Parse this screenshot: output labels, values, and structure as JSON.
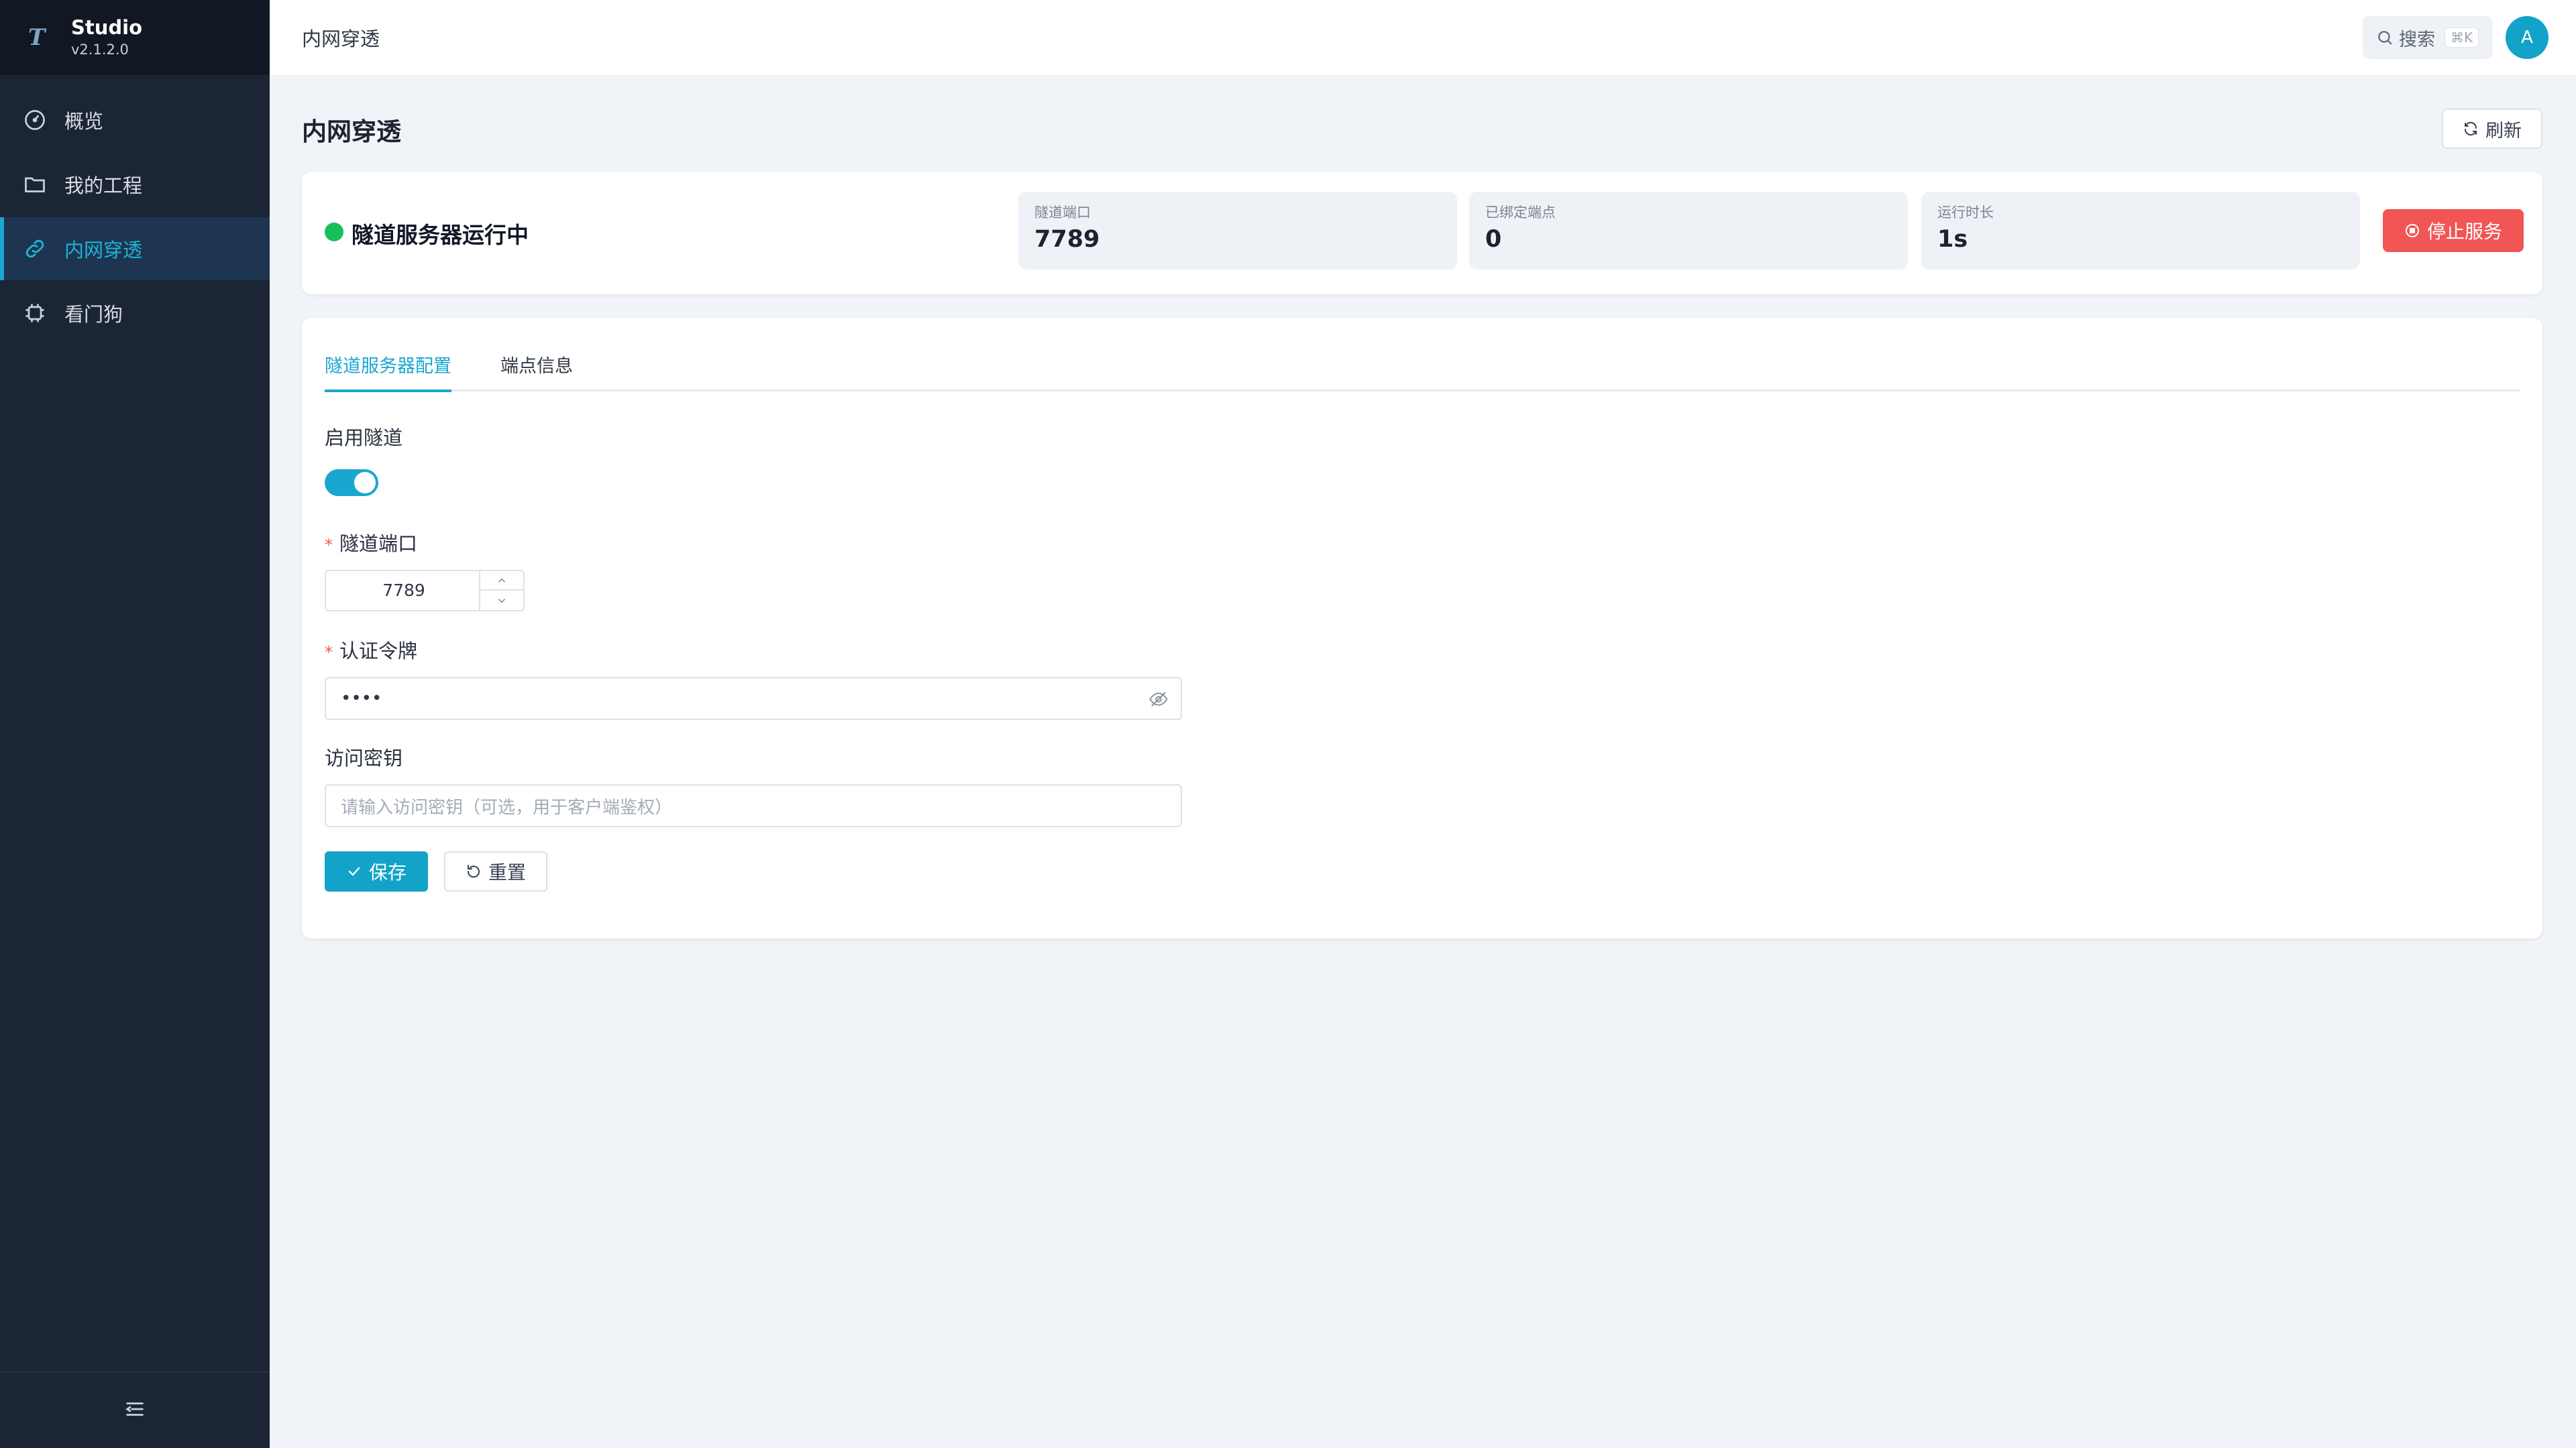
{
  "app": {
    "name": "Studio",
    "version": "v2.1.2.0",
    "logo_letter": "T"
  },
  "sidebar": {
    "items": [
      {
        "label": "概览",
        "icon": "gauge-icon"
      },
      {
        "label": "我的工程",
        "icon": "folder-icon"
      },
      {
        "label": "内网穿透",
        "icon": "link-icon",
        "active": true
      },
      {
        "label": "看门狗",
        "icon": "chip-icon"
      }
    ],
    "collapse_icon": "collapse-menu-icon"
  },
  "header": {
    "breadcrumb": "内网穿透",
    "search_label": "搜索",
    "search_shortcut": "⌘K",
    "avatar_letter": "A"
  },
  "page": {
    "title": "内网穿透",
    "refresh_label": "刷新"
  },
  "status": {
    "text": "隧道服务器运行中",
    "color": "#16c05c",
    "stats": [
      {
        "label": "隧道端口",
        "value": "7789"
      },
      {
        "label": "已绑定端点",
        "value": "0"
      },
      {
        "label": "运行时长",
        "value": "1s"
      }
    ],
    "stop_label": "停止服务"
  },
  "config": {
    "tabs": [
      {
        "label": "隧道服务器配置",
        "active": true
      },
      {
        "label": "端点信息"
      }
    ],
    "enable_label": "启用隧道",
    "enable_on": true,
    "port_label": "隧道端口",
    "port_value": "7789",
    "token_label": "认证令牌",
    "token_value": "••••",
    "access_key_label": "访问密钥",
    "access_key_placeholder": "请输入访问密钥（可选，用于客户端鉴权）",
    "save_label": "保存",
    "reset_label": "重置"
  },
  "colors": {
    "accent": "#13a3c9",
    "danger": "#f25555",
    "sidebar_bg": "#1c2534"
  }
}
